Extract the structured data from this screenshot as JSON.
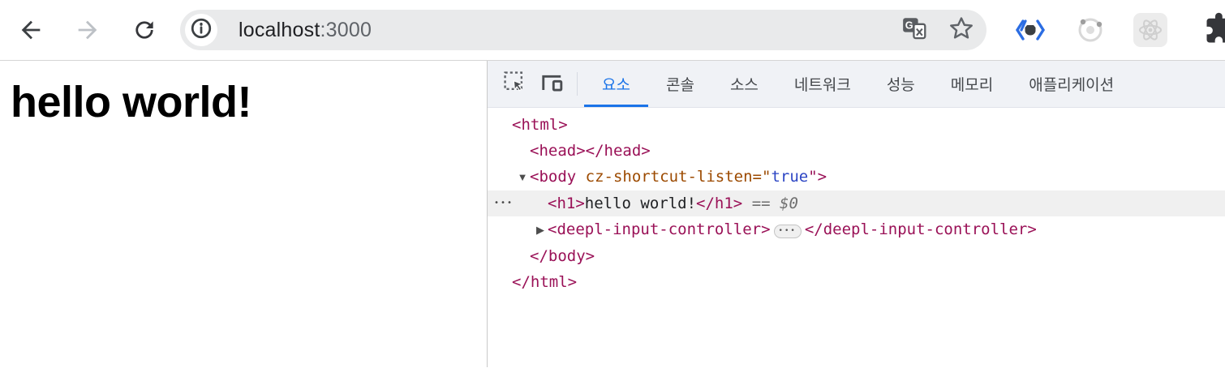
{
  "browser": {
    "url": {
      "host": "localhost",
      "port": ":3000"
    },
    "icons": {
      "back": "back-arrow-icon",
      "forward": "forward-arrow-icon",
      "reload": "reload-icon",
      "site_info": "info-circle-icon",
      "translate": "google-translate-icon",
      "bookmark": "star-outline-icon",
      "extension_1": "github-code-extension-icon",
      "extension_2": "orbit-extension-icon",
      "extension_3": "react-devtools-extension-icon",
      "extensions_menu": "puzzle-piece-icon"
    },
    "colors": {
      "omnibox_bg": "#e9eaeb",
      "url_text": "#202124",
      "url_muted": "#5f6368"
    }
  },
  "page": {
    "heading": "hello world!"
  },
  "devtools": {
    "toolbar_icons": {
      "inspect": "inspect-element-icon",
      "device": "device-toolbar-icon"
    },
    "tabs": [
      {
        "label": "요소",
        "active": true
      },
      {
        "label": "콘솔",
        "active": false
      },
      {
        "label": "소스",
        "active": false
      },
      {
        "label": "네트워크",
        "active": false
      },
      {
        "label": "성능",
        "active": false
      },
      {
        "label": "메모리",
        "active": false
      },
      {
        "label": "애플리케이션",
        "active": false
      }
    ],
    "tree": {
      "html_open": "<html>",
      "head_row": "<head></head>",
      "body_expander": "▼",
      "body_open": "<body ",
      "body_attr_name": "cz-shortcut-listen",
      "body_attr_eq": "=\"",
      "body_attr_value": "true",
      "body_end_bracket": "\">",
      "h1_gutter_dots": "•••",
      "h1_open": "<h1>",
      "h1_text": "hello world!",
      "h1_close": "</h1>",
      "h1_selected_hint": " == ",
      "h1_dollar_ref": "$0",
      "deepl_expander": "▶",
      "deepl_open": "<deepl-input-controller>",
      "deepl_collapsed_dots": "•••",
      "deepl_close": "</deepl-input-controller>",
      "body_close": "</body>",
      "html_close": "</html>"
    },
    "colors": {
      "accent_blue": "#1a73e8",
      "tag": "#9a1157",
      "attr_name": "#9c4a00",
      "attr_value": "#2c45c4",
      "selected_row_bg": "#f0f0f0",
      "tabbar_bg": "#f0f2f6"
    }
  }
}
